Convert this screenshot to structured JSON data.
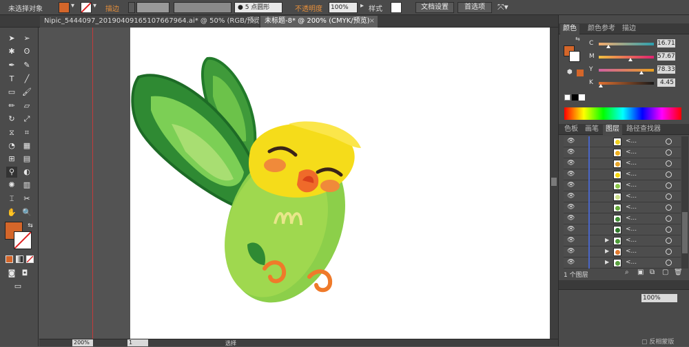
{
  "control_bar": {
    "selection_label": "未选择对象",
    "stroke_label": "描边",
    "stroke_color_menu": "▾",
    "stroke_swatch_icon": "slash-swatch",
    "brush_label": "5 点圆形",
    "opacity_label": "不透明度",
    "opacity_value": "100%",
    "style_label": "样式",
    "doc_settings_button": "文档设置",
    "preferences_button": "首选项",
    "fill_color": "#d4662a"
  },
  "tabs": [
    {
      "label": "Nipic_5444097_20190409165107667964.ai* @ 50% (RGB/预览)",
      "close": "×"
    },
    {
      "label": "未标题-8* @ 200% (CMYK/预览)",
      "close": "×"
    }
  ],
  "color_panel": {
    "tabs": [
      "颜色",
      "颜色参考",
      "描边"
    ],
    "channels": [
      {
        "name": "C",
        "value": "16.71",
        "fraction": 0.17
      },
      {
        "name": "M",
        "value": "57.67",
        "fraction": 0.58
      },
      {
        "name": "Y",
        "value": "78.33",
        "fraction": 0.78
      },
      {
        "name": "K",
        "value": "4.45",
        "fraction": 0.04
      }
    ]
  },
  "layers_panel": {
    "tabs": [
      "色板",
      "画笔",
      "图层",
      "路径查找器"
    ],
    "rows": [
      {
        "name": "<...",
        "thumb": "#f0d020"
      },
      {
        "name": "<...",
        "thumb": "#f0b020"
      },
      {
        "name": "<...",
        "thumb": "#e7a52a"
      },
      {
        "name": "<...",
        "thumb": "#f5d710"
      },
      {
        "name": "<...",
        "thumb": "#8cc84a"
      },
      {
        "name": "<...",
        "thumb": "#cde08a"
      },
      {
        "name": "<...",
        "thumb": "#66aa3a"
      },
      {
        "name": "<...",
        "thumb": "#3f8f33"
      },
      {
        "name": "<...",
        "thumb": "#2f7a2a"
      },
      {
        "name": "<...",
        "thumb": "#4a9a36"
      },
      {
        "name": "<...",
        "thumb": "#e07a30"
      },
      {
        "name": "<...",
        "thumb": "#5aa040"
      }
    ],
    "footer_label": "1 个图层"
  },
  "status": {
    "zoom": "200%",
    "page": "1",
    "mode": "选择"
  },
  "swatch_panel_footer": "反相蒙版",
  "bottom_panel_value": "100%"
}
